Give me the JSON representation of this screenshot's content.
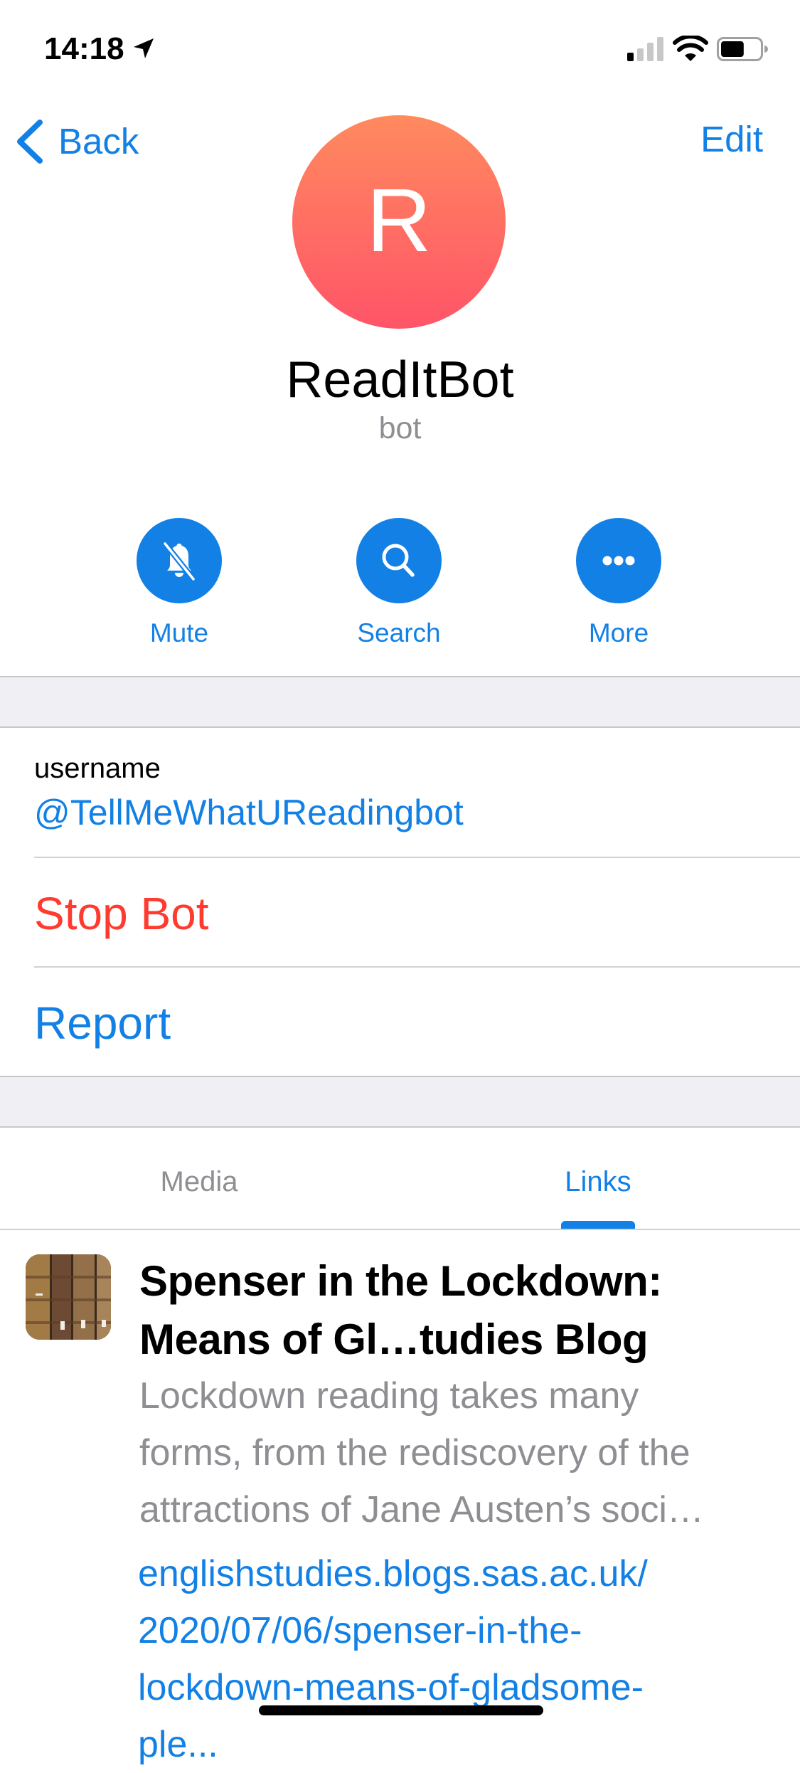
{
  "status_bar": {
    "time": "14:18",
    "location_icon": "location-arrow-icon",
    "signal_bars_filled": 1,
    "signal_bars_total": 4,
    "wifi_icon": "wifi-icon",
    "battery_level": 0.6
  },
  "nav": {
    "back_label": "Back",
    "edit_label": "Edit"
  },
  "profile": {
    "avatar_letter": "R",
    "avatar_gradient": [
      "#FF8A5E",
      "#FF5468"
    ],
    "name": "ReadItBot",
    "subtitle": "bot"
  },
  "actions": [
    {
      "label": "Mute",
      "icon": "bell-slash-icon"
    },
    {
      "label": "Search",
      "icon": "search-icon"
    },
    {
      "label": "More",
      "icon": "more-dots-icon"
    }
  ],
  "info": {
    "username_label": "username",
    "username_value": "@TellMeWhatUReadingbot",
    "stop_bot_label": "Stop Bot",
    "report_label": "Report"
  },
  "tabs": [
    {
      "label": "Media",
      "active": false
    },
    {
      "label": "Links",
      "active": true
    }
  ],
  "links": [
    {
      "thumbnail": "books-thumbnail",
      "title_lines": [
        "Spenser in the Lockdown:",
        "Means of Gl…tudies Blog"
      ],
      "description_lines": [
        "Lockdown reading takes many",
        "forms, from the rediscovery of the",
        "attractions of Jane Austen’s soci…"
      ],
      "url_lines": [
        "englishstudies.blogs.sas.ac.uk/",
        "2020/07/06/spenser-in-the-",
        "lockdown-means-of-gladsome-",
        "ple..."
      ]
    }
  ],
  "colors": {
    "accent": "#1280E5",
    "destructive": "#FF3B30",
    "secondary_text": "#8E8E93",
    "grouped_background": "#EFEFF4"
  }
}
